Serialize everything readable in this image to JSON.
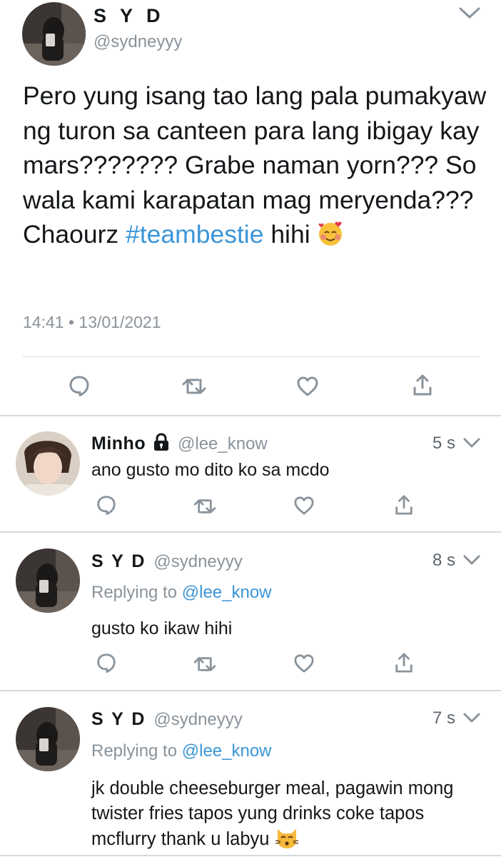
{
  "main_tweet": {
    "name": "S Y D",
    "handle": "@sydneyyy",
    "text_before_hashtag": "Pero yung isang tao lang pala pumakyaw ng turon sa canteen para lang ibigay kay mars??????? Grabe naman yorn??? So wala kami karapatan mag meryenda??? Chaourz ",
    "hashtag": "#teambestie",
    "text_after_hashtag": " hihi",
    "time": "14:41",
    "separator": "•",
    "date": "13/01/2021"
  },
  "replies": [
    {
      "name": "Minho",
      "locked": true,
      "handle": "@lee_know",
      "time": "5 s",
      "replying_to": null,
      "text": "ano gusto mo dito ko sa mcdo"
    },
    {
      "name": "S Y D",
      "handle": "@sydneyyy",
      "time": "8 s",
      "replying_label": "Replying to",
      "replying_to": "@lee_know",
      "text": "gusto ko ikaw hihi"
    },
    {
      "name": "S Y D",
      "handle": "@sydneyyy",
      "time": "7 s",
      "replying_label": "Replying to",
      "replying_to": "@lee_know",
      "text": "jk double cheeseburger meal, pagawin mong twister fries tapos yung drinks coke tapos mcflurry thank u labyu"
    }
  ],
  "icons": {
    "reply": "reply-bubble-icon",
    "retweet": "retweet-icon",
    "like": "heart-icon",
    "share": "share-icon",
    "menu": "chevron-down-icon",
    "lock": "lock-icon",
    "emoji_main": "smiling-face-with-hearts-emoji",
    "emoji_reply": "kissing-cat-emoji"
  },
  "colors": {
    "link": "#3a95d8",
    "muted": "#8a939b",
    "text": "#14171a",
    "divider": "#d6d9dc"
  }
}
